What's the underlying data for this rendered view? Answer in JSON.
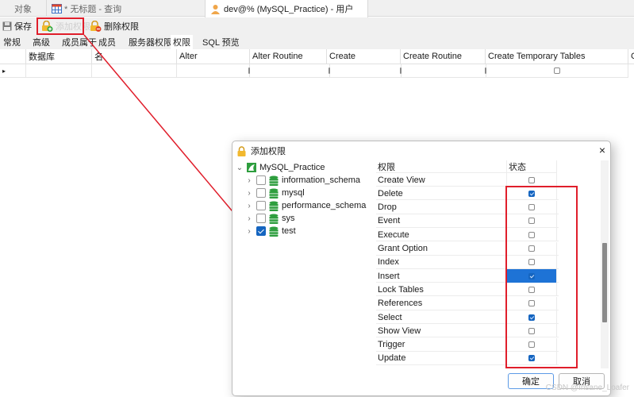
{
  "window_tabs": [
    {
      "label": "对象",
      "icon": "none",
      "active": false
    },
    {
      "label": "* 无标题 - 查询",
      "icon": "query-table-icon",
      "active": false
    },
    {
      "label": "dev@% (MySQL_Practice) - 用户",
      "icon": "user-icon",
      "active": true
    }
  ],
  "toolbar": {
    "save_label": "保存",
    "add_priv_label": "添加权限",
    "delete_priv_label": "删除权限"
  },
  "subtabs": [
    "常规",
    "高级",
    "成员属于",
    "成员",
    "服务器权限",
    "权限",
    "SQL 预览"
  ],
  "active_subtab": "权限",
  "grid": {
    "columns": [
      "数据库",
      "名",
      "Alter",
      "Alter Routine",
      "Create",
      "Create Routine",
      "Create Temporary Tables",
      "C"
    ],
    "row_marker": "▸"
  },
  "dialog": {
    "title": "添加权限",
    "close_label": "×",
    "tree": {
      "root": "MySQL_Practice",
      "children": [
        {
          "label": "information_schema",
          "checked": false
        },
        {
          "label": "mysql",
          "checked": false
        },
        {
          "label": "performance_schema",
          "checked": false
        },
        {
          "label": "sys",
          "checked": false
        },
        {
          "label": "test",
          "checked": true
        }
      ]
    },
    "privileges_header": "权限",
    "state_header": "状态",
    "privileges": [
      {
        "name": "Create View",
        "checked": false,
        "selected": false
      },
      {
        "name": "Delete",
        "checked": true,
        "selected": false
      },
      {
        "name": "Drop",
        "checked": false,
        "selected": false
      },
      {
        "name": "Event",
        "checked": false,
        "selected": false
      },
      {
        "name": "Execute",
        "checked": false,
        "selected": false
      },
      {
        "name": "Grant Option",
        "checked": false,
        "selected": false
      },
      {
        "name": "Index",
        "checked": false,
        "selected": false
      },
      {
        "name": "Insert",
        "checked": true,
        "selected": true
      },
      {
        "name": "Lock Tables",
        "checked": false,
        "selected": false
      },
      {
        "name": "References",
        "checked": false,
        "selected": false
      },
      {
        "name": "Select",
        "checked": true,
        "selected": false
      },
      {
        "name": "Show View",
        "checked": false,
        "selected": false
      },
      {
        "name": "Trigger",
        "checked": false,
        "selected": false
      },
      {
        "name": "Update",
        "checked": true,
        "selected": false
      }
    ],
    "ok_label": "确定",
    "cancel_label": "取消"
  },
  "watermark": "CSDN @Insane_Loafer",
  "colors": {
    "annotation_red": "#e01e2b",
    "selection_blue": "#1e73d6",
    "checkbox_blue": "#1565c0",
    "db_green": "#2e9e3e"
  }
}
